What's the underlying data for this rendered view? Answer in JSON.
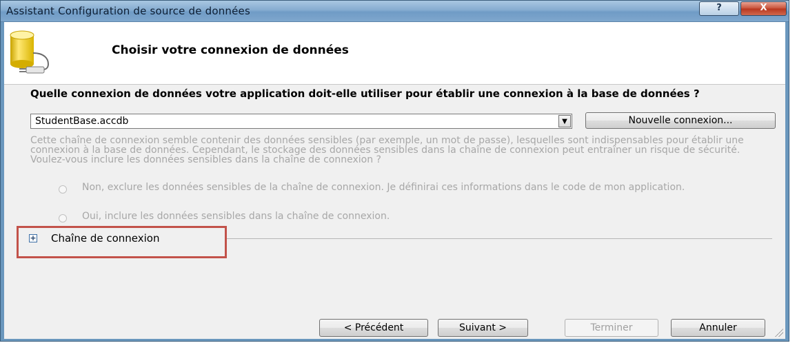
{
  "window": {
    "title": "Assistant Configuration de source de données",
    "help_label": "?",
    "close_label": "X"
  },
  "header": {
    "title": "Choisir votre connexion de données",
    "icon": "database-plug-icon"
  },
  "connection": {
    "question": "Quelle connexion de données votre application doit-elle utiliser pour établir une connexion à la base de données ?",
    "selected_value": "StudentBase.accdb",
    "dropdown_arrow": "▼",
    "new_connection_label": "Nouvelle connexion..."
  },
  "sensitive": {
    "info": "Cette chaîne de connexion semble contenir des données sensibles (par exemple, un mot de passe), lesquelles sont indispensables pour établir une connexion à la base de données. Cependant, le stockage des données sensibles dans la chaîne de connexion peut entraîner un risque de sécurité. Voulez-vous inclure les données sensibles dans la chaîne de connexion ?",
    "option_no": "Non, exclure les données sensibles de la chaîne de connexion. Je définirai ces informations dans le code de mon application.",
    "option_yes": "Oui, inclure les données sensibles dans la chaîne de connexion."
  },
  "connection_string": {
    "expand_symbol": "+",
    "label": "Chaîne de connexion"
  },
  "footer": {
    "prev_label": "< Précédent",
    "next_label": "Suivant >",
    "finish_label": "Terminer",
    "cancel_label": "Annuler"
  },
  "colors": {
    "highlight_border": "#c2524a",
    "disabled_text": "#a7a7a7",
    "titlebar": "#86acd0"
  }
}
